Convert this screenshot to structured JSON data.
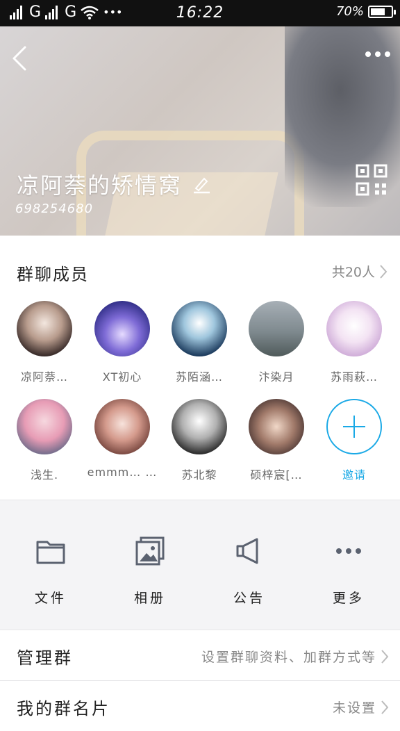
{
  "status_bar": {
    "signal_1": "G",
    "signal_2": "G",
    "more": "•••",
    "time": "16:22",
    "battery_text": "70%",
    "battery_level": 0.7
  },
  "header": {
    "group_name": "凉阿萘的矫情窝",
    "group_id": "698254680"
  },
  "members": {
    "title": "群聊成员",
    "count_text": "共20人",
    "items": [
      {
        "label": "凉阿萘…"
      },
      {
        "label": "XT初心"
      },
      {
        "label": "苏陌涵…"
      },
      {
        "label": "汴染月"
      },
      {
        "label": "苏雨萩…"
      },
      {
        "label": "浅生."
      },
      {
        "label": "emmm… …"
      },
      {
        "label": "苏北黎"
      },
      {
        "label": "硕梓宸[…"
      }
    ],
    "invite_label": "邀请"
  },
  "actions": [
    {
      "label": "文件",
      "icon": "folder-icon"
    },
    {
      "label": "相册",
      "icon": "photo-album-icon"
    },
    {
      "label": "公告",
      "icon": "megaphone-icon"
    },
    {
      "label": "更多",
      "icon": "more-icon"
    }
  ],
  "rows": [
    {
      "label": "管理群",
      "value": "设置群聊资料、加群方式等"
    },
    {
      "label": "我的群名片",
      "value": "未设置"
    }
  ],
  "colors": {
    "accent": "#1aa9e6",
    "status_bar": "#111111",
    "panel_bg": "#f4f4f6"
  }
}
